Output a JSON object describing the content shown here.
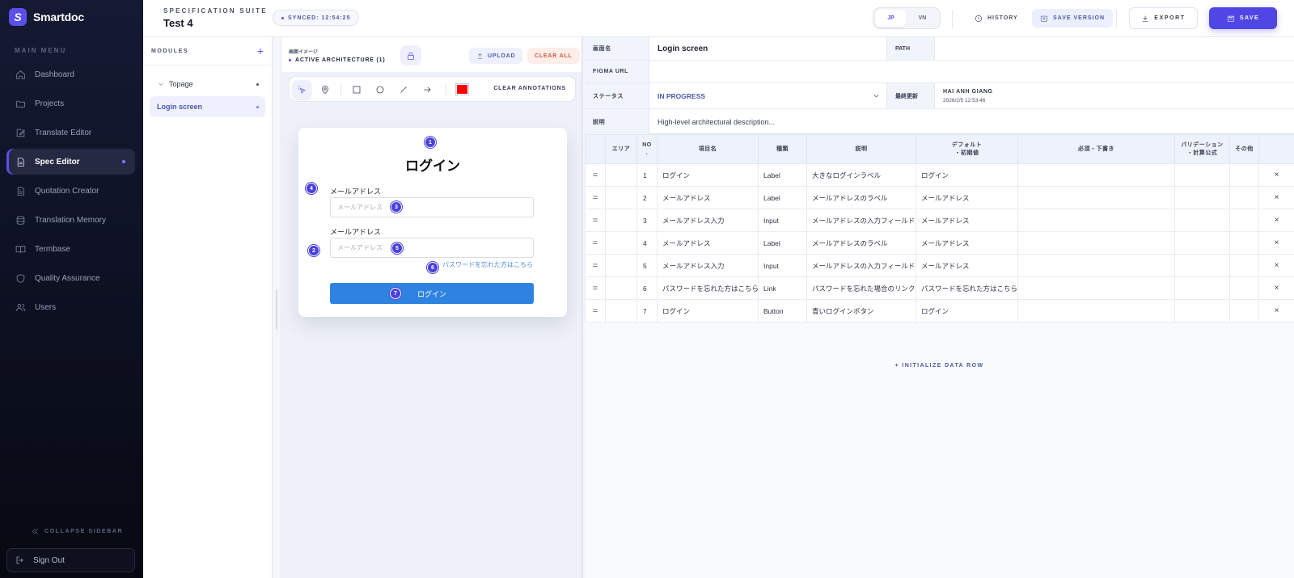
{
  "sidebar": {
    "brand_letter": "S",
    "brand_name": "Smartdoc",
    "menu_title": "MAIN MENU",
    "items": [
      {
        "label": "Dashboard",
        "icon": "home-icon"
      },
      {
        "label": "Projects",
        "icon": "folder-icon"
      },
      {
        "label": "Translate Editor",
        "icon": "edit-icon"
      },
      {
        "label": "Spec Editor",
        "icon": "document-icon",
        "active": true
      },
      {
        "label": "Quotation Creator",
        "icon": "receipt-icon"
      },
      {
        "label": "Translation Memory",
        "icon": "database-icon"
      },
      {
        "label": "Termbase",
        "icon": "book-icon"
      },
      {
        "label": "Quality Assurance",
        "icon": "shield-icon"
      },
      {
        "label": "Users",
        "icon": "users-icon"
      }
    ],
    "collapse_label": "COLLAPSE SIDEBAR",
    "signout_label": "Sign Out"
  },
  "header": {
    "suite_label": "SPECIFICATION SUITE",
    "doc_title": "Test 4",
    "synced": "SYNCED: 12:54:25",
    "lang_jp": "JP",
    "lang_vn": "VN",
    "history": "HISTORY",
    "save_version": "SAVE VERSION",
    "export": "EXPORT",
    "save": "SAVE"
  },
  "modules": {
    "title": "MODULES",
    "add": "+",
    "parent": "Topage",
    "child": "Login screen"
  },
  "canvas": {
    "image_label": "画面イメージ",
    "architecture": "ACTIVE ARCHITECTURE (1)",
    "upload": "UPLOAD",
    "clear_all": "CLEAR ALL",
    "clear_annotations": "CLEAR ANNOTATIONS",
    "annotation_color": "#ff0000"
  },
  "mockup": {
    "title": "ログイン",
    "email_label_1": "メールアドレス",
    "email_placeholder_1": "メールアドレス",
    "email_label_2": "メールアドレス",
    "email_placeholder_2": "メールアドレス",
    "forgot_link": "パスワードを忘れた方はこちら",
    "login_button": "ログイン",
    "markers": [
      "1",
      "2",
      "3",
      "4",
      "5",
      "6",
      "7"
    ]
  },
  "props": {
    "screen_name_label": "画面名",
    "screen_name": "Login screen",
    "path_label": "PATH",
    "path": "",
    "figma_label": "FIGMA URL",
    "figma": "",
    "status_label": "ステータス",
    "status": "IN PROGRESS",
    "updated_label": "最終更新",
    "updated_by": "HAI ANH GIANG",
    "updated_at": "2026/2/5 12:53:46",
    "desc_label": "説明",
    "description": "High-level architectural description..."
  },
  "table": {
    "headers": {
      "area": "エリア",
      "no": "NO\n.",
      "item": "項目名",
      "type": "種類",
      "desc": "説明",
      "default": "デフォルト\n・初期値",
      "required": "必須・下書き",
      "validation": "バリデーション\n・計算公式",
      "other": "その他"
    },
    "rows": [
      {
        "no": "1",
        "item": "ログイン",
        "type": "Label",
        "desc": "大きなログインラベル",
        "default": "ログイン"
      },
      {
        "no": "2",
        "item": "メールアドレス",
        "type": "Label",
        "desc": "メールアドレスのラベル",
        "default": "メールアドレス"
      },
      {
        "no": "3",
        "item": "メールアドレス入力",
        "type": "Input",
        "desc": "メールアドレスの入力フィールド",
        "default": "メールアドレス"
      },
      {
        "no": "4",
        "item": "メールアドレス",
        "type": "Label",
        "desc": "メールアドレスのラベル",
        "default": "メールアドレス"
      },
      {
        "no": "5",
        "item": "メールアドレス入力",
        "type": "Input",
        "desc": "メールアドレスの入力フィールド",
        "default": "メールアドレス"
      },
      {
        "no": "6",
        "item": "パスワードを忘れた方はこちら",
        "type": "Link",
        "desc": "パスワードを忘れた場合のリンク",
        "default": "パスワードを忘れた方はこちら"
      },
      {
        "no": "7",
        "item": "ログイン",
        "type": "Button",
        "desc": "青いログインボタン",
        "default": "ログイン"
      }
    ],
    "handle_symbol": "=",
    "delete_symbol": "×",
    "init_row": "+ INITIALIZE DATA ROW"
  }
}
